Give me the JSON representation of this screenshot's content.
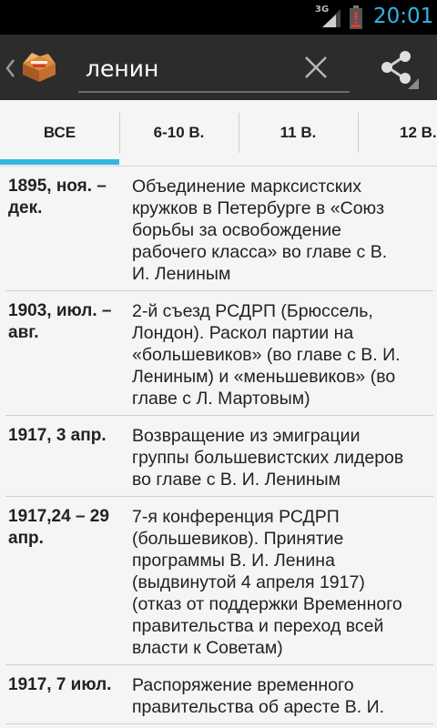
{
  "status_bar": {
    "network": "3G",
    "time": "20:01"
  },
  "action_bar": {
    "search_value": "ленин",
    "back_icon": "chevron-left-icon",
    "app_icon": "open-box-icon",
    "clear_icon": "close-icon",
    "share_icon": "share-icon"
  },
  "tabs": [
    {
      "label": "ВСЕ",
      "selected": true
    },
    {
      "label": "6-10 В."
    },
    {
      "label": "11 В."
    },
    {
      "label": "12 В."
    }
  ],
  "colors": {
    "accent": "#33b5e5",
    "action_bar": "#2c2c2c",
    "status_bar": "#000000",
    "background": "#f5f5f5"
  },
  "events": [
    {
      "date": "1895, ноя. – дек.",
      "text": "Объединение марксистских кружков в Петербурге в «Союз борьбы за освобождение рабочего класса» во главе с В. И. Лениным"
    },
    {
      "date": "1903, июл. – авг.",
      "text": "2-й съезд РСДРП (Брюссель, Лондон). Раскол партии на «большевиков» (во главе с В. И. Лениным) и «меньшевиков» (во главе с Л. Мартовым)"
    },
    {
      "date": "1917, 3 апр.",
      "text": "Возвращение из эмиграции группы большевистских лидеров во главе с В. И. Лениным"
    },
    {
      "date": "1917,24 – 29 апр.",
      "text": "7-я конференция РСДРП (большевиков). Принятие программы В. И. Ленина (выдвинутой 4 апреля 1917) (отказ от поддержки Временного правительства и переход всей власти к Советам)"
    },
    {
      "date": "1917, 7 июл.",
      "text": "Распоряжение временного правительства об аресте В. И."
    }
  ]
}
